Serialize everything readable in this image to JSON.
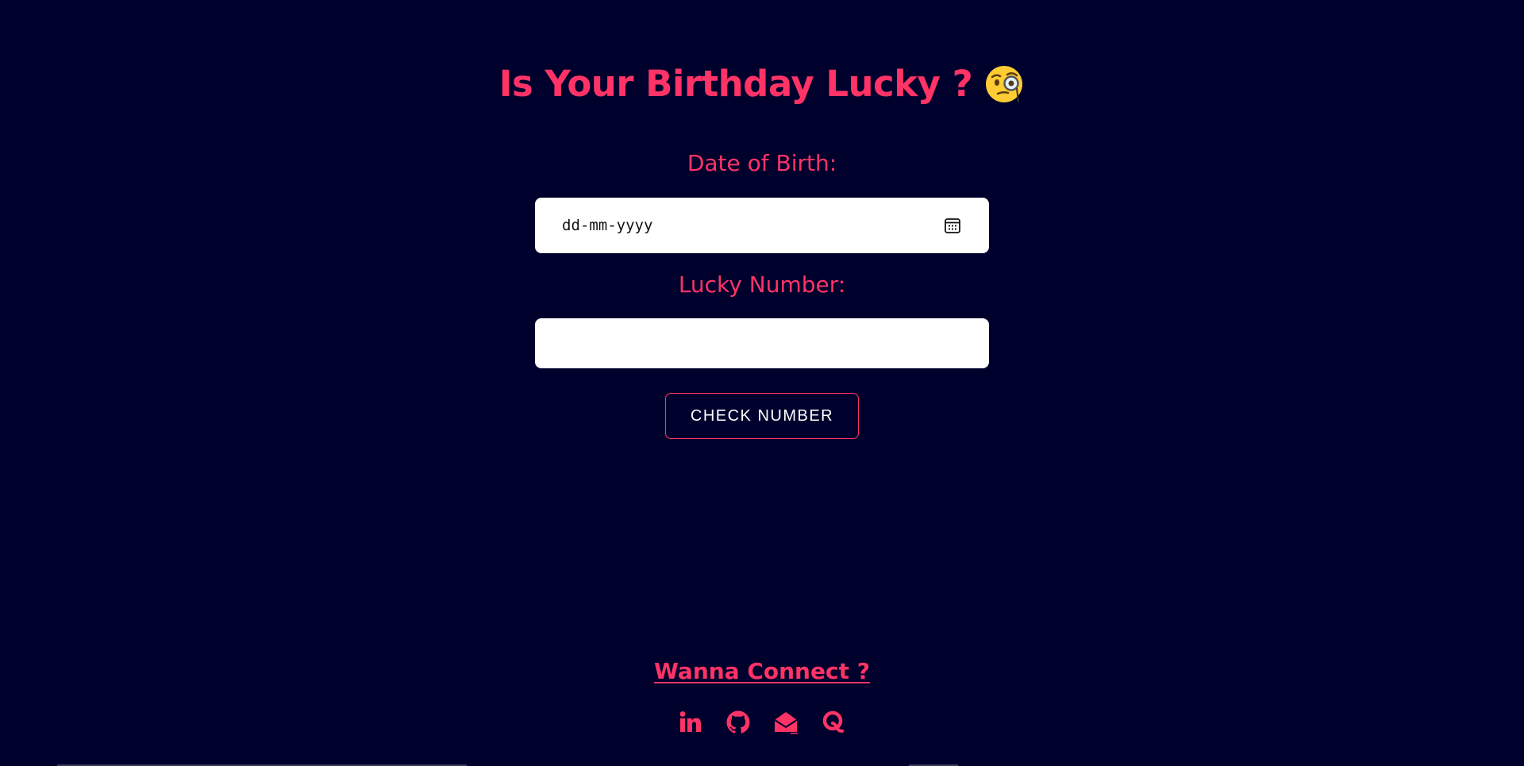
{
  "header": {
    "title": "Is Your Birthday Lucky ?",
    "emoji": "face-with-monocle-emoji"
  },
  "form": {
    "dob_label": "Date of Birth:",
    "dob_placeholder": "dd-mm-yyyy",
    "dob_value": "",
    "lucky_label": "Lucky Number:",
    "lucky_value": "",
    "check_button": "CHECK NUMBER"
  },
  "footer": {
    "connect_label": "Wanna Connect ?",
    "social_icons": [
      "linkedin-icon",
      "github-icon",
      "email-icon",
      "quora-icon"
    ]
  },
  "colors": {
    "background": "#00002d",
    "accent": "#ff3366",
    "field_bg": "#ffffff",
    "button_text": "#ffffff"
  }
}
